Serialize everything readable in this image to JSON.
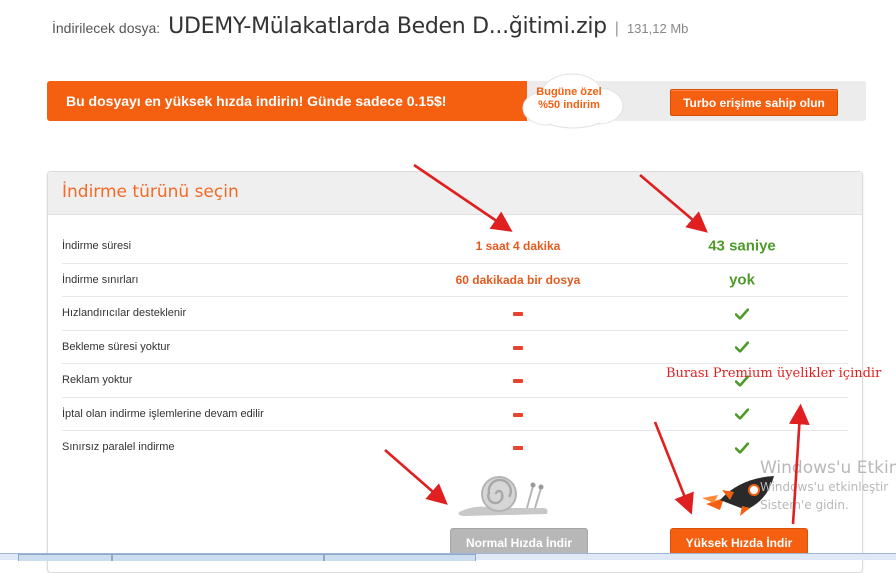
{
  "header": {
    "label": "İndirilecek dosya:",
    "filename": "UDEMY-Mülakatlarda Beden D...ğitimi.zip",
    "separator": "|",
    "size": "131,12 Mb"
  },
  "promo": {
    "text": "Bu dosyayı en yüksek hızda indirin! Günde sadece 0.15$!",
    "cloud_line1": "Bugüne özel",
    "cloud_line2": "%50 indirim",
    "turbo_label": "Turbo erişime sahip olun"
  },
  "panel": {
    "title": "İndirme türünü seçin",
    "rows": [
      {
        "label": "İndirme süresi",
        "normal": "1 saat 4 dakika",
        "fast": "43 saniye"
      },
      {
        "label": "İndirme sınırları",
        "normal": "60 dakikada bir dosya",
        "fast": "yok"
      },
      {
        "label": "Hızlandırıcılar desteklenir",
        "normal_icon": "dash-icon",
        "fast_icon": "check-icon"
      },
      {
        "label": "Bekleme süresi yoktur",
        "normal_icon": "dash-icon",
        "fast_icon": "check-icon"
      },
      {
        "label": "Reklam yoktur",
        "normal_icon": "dash-icon",
        "fast_icon": "check-icon"
      },
      {
        "label": "İptal olan indirme işlemlerine devam edilir",
        "normal_icon": "dash-icon",
        "fast_icon": "check-icon"
      },
      {
        "label": "Sınırsız paralel indirme",
        "normal_icon": "dash-icon",
        "fast_icon": "check-icon"
      }
    ],
    "normal_button": "Normal Hızda İndir",
    "fast_button": "Yüksek Hızda İndir"
  },
  "annotation": "Burası Premium üyelikler içindir",
  "watermark": {
    "line1": "Windows'u Etkin",
    "line2": "Windows'u etkinleştir",
    "line3": "Sistem'e gidin."
  },
  "colors": {
    "accent": "#f55f10",
    "title": "#f26a25",
    "success": "#4e9a2a",
    "dash": "#e8432d",
    "annotation": "#e02020"
  }
}
